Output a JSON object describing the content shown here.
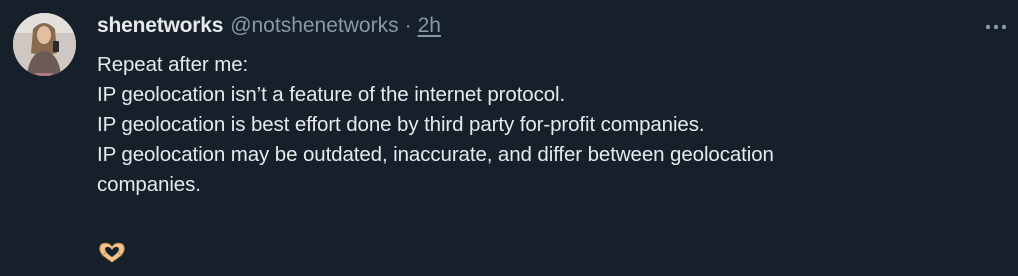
{
  "tweet": {
    "display_name": "shenetworks",
    "handle": "@notshenetworks",
    "separator": "·",
    "time": "2h",
    "lines": [
      "Repeat after me:",
      "IP geolocation isn’t a feature of the internet protocol.",
      "IP geolocation is best effort done by third party for-profit companies.",
      "IP geolocation may be outdated, inaccurate, and differ between geolocation",
      "companies."
    ],
    "emoji": "heart-hands-icon",
    "more_icon": "more-options-icon"
  },
  "colors": {
    "background": "#15202b",
    "primary_text": "#e7e9ea",
    "secondary_text": "#8b98a5"
  }
}
